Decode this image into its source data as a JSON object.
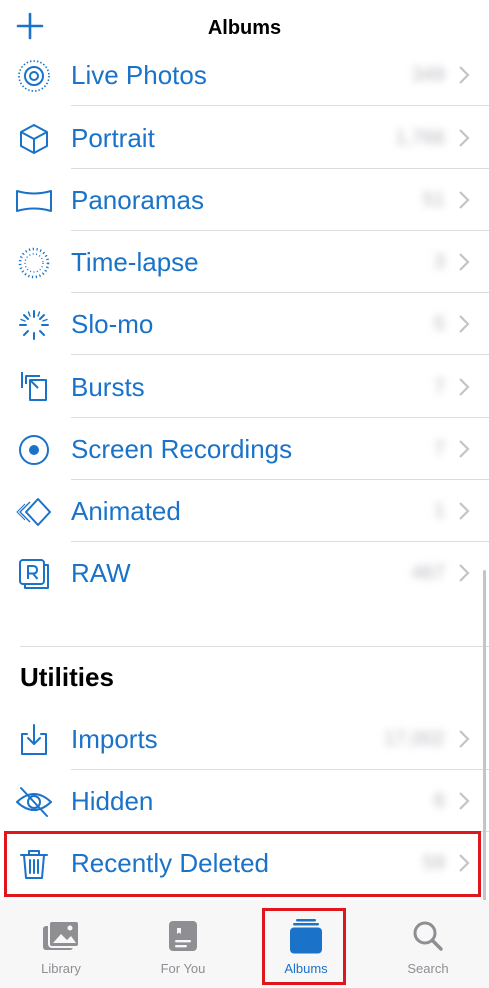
{
  "nav": {
    "title": "Albums",
    "add_icon": "plus-icon"
  },
  "media_types": [
    {
      "label": "Live Photos",
      "count": "349",
      "icon": "live-photos-icon"
    },
    {
      "label": "Portrait",
      "count": "1,766",
      "icon": "portrait-cube-icon"
    },
    {
      "label": "Panoramas",
      "count": "51",
      "icon": "panorama-icon"
    },
    {
      "label": "Time-lapse",
      "count": "3",
      "icon": "time-lapse-icon"
    },
    {
      "label": "Slo-mo",
      "count": "5",
      "icon": "slo-mo-icon"
    },
    {
      "label": "Bursts",
      "count": "7",
      "icon": "bursts-icon"
    },
    {
      "label": "Screen Recordings",
      "count": "7",
      "icon": "screen-recording-icon"
    },
    {
      "label": "Animated",
      "count": "1",
      "icon": "animated-icon"
    },
    {
      "label": "RAW",
      "count": "467",
      "icon": "raw-icon"
    }
  ],
  "utilities": {
    "title": "Utilities",
    "items": [
      {
        "label": "Imports",
        "count": "17,002",
        "icon": "import-icon"
      },
      {
        "label": "Hidden",
        "count": "6",
        "icon": "hidden-eye-icon"
      },
      {
        "label": "Recently Deleted",
        "count": "59",
        "icon": "trash-icon"
      }
    ]
  },
  "tabs": [
    {
      "label": "Library",
      "icon": "library-icon",
      "active": false
    },
    {
      "label": "For You",
      "icon": "for-you-icon",
      "active": false
    },
    {
      "label": "Albums",
      "icon": "albums-icon",
      "active": true
    },
    {
      "label": "Search",
      "icon": "search-icon",
      "active": false
    }
  ],
  "colors": {
    "accent": "#1a73c9",
    "highlight": "#e0161e",
    "tab_inactive": "#8e8e93"
  }
}
